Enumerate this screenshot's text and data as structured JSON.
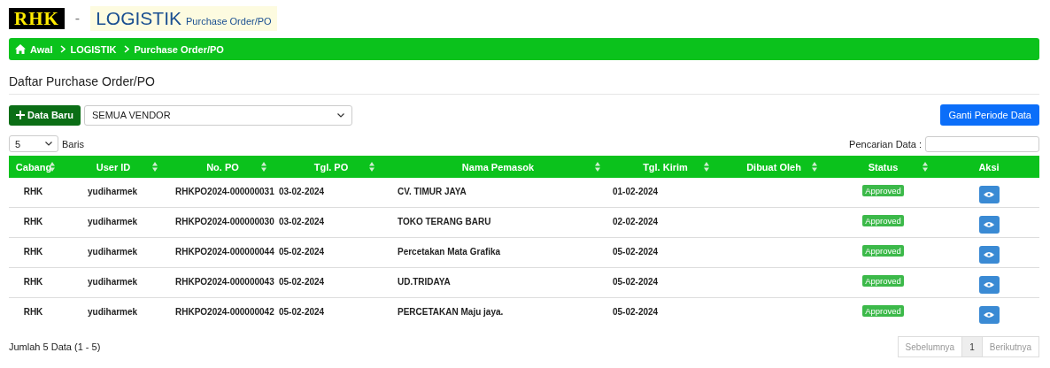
{
  "header": {
    "logo": "RHK",
    "separator": "-",
    "title": "LOGISTIK",
    "subtitle": "Purchase Order/PO"
  },
  "breadcrumb": [
    "Awal",
    "LOGISTIK",
    "Purchase Order/PO"
  ],
  "page_title": "Daftar Purchase Order/PO",
  "toolbar": {
    "new_button": "Data Baru",
    "vendor_select": "SEMUA VENDOR",
    "period_button": "Ganti Periode Data"
  },
  "page_size": {
    "value": "5",
    "label": "Baris"
  },
  "search": {
    "label": "Pencarian Data :"
  },
  "table": {
    "columns": [
      {
        "label": "Cabang",
        "sortable": true
      },
      {
        "label": "User ID",
        "sortable": true
      },
      {
        "label": "No. PO",
        "sortable": true
      },
      {
        "label": "Tgl. PO",
        "sortable": true
      },
      {
        "label": "Nama Pemasok",
        "sortable": true
      },
      {
        "label": "Tgl. Kirim",
        "sortable": true
      },
      {
        "label": "Dibuat Oleh",
        "sortable": true
      },
      {
        "label": "Status",
        "sortable": true
      },
      {
        "label": "Aksi",
        "sortable": false
      }
    ],
    "rows": [
      {
        "cabang": "RHK",
        "user_id": "yudiharmek",
        "no_po": "RHKPO2024-000000031",
        "tgl_po": "03-02-2024",
        "pemasok": "CV. TIMUR JAYA",
        "tgl_kirim": "01-02-2024",
        "status": "Approved"
      },
      {
        "cabang": "RHK",
        "user_id": "yudiharmek",
        "no_po": "RHKPO2024-000000030",
        "tgl_po": "03-02-2024",
        "pemasok": "TOKO TERANG BARU",
        "tgl_kirim": "02-02-2024",
        "status": "Approved"
      },
      {
        "cabang": "RHK",
        "user_id": "yudiharmek",
        "no_po": "RHKPO2024-000000044",
        "tgl_po": "05-02-2024",
        "pemasok": "Percetakan Mata Grafika",
        "tgl_kirim": "05-02-2024",
        "status": "Approved"
      },
      {
        "cabang": "RHK",
        "user_id": "yudiharmek",
        "no_po": "RHKPO2024-000000043",
        "tgl_po": "05-02-2024",
        "pemasok": "UD.TRIDAYA",
        "tgl_kirim": "05-02-2024",
        "status": "Approved"
      },
      {
        "cabang": "RHK",
        "user_id": "yudiharmek",
        "no_po": "RHKPO2024-000000042",
        "tgl_po": "05-02-2024",
        "pemasok": "PERCETAKAN Maju jaya.",
        "tgl_kirim": "05-02-2024",
        "status": "Approved"
      }
    ]
  },
  "footer": {
    "summary": "Jumlah 5 Data (1 - 5)"
  },
  "pagination": [
    {
      "label": "Sebelumnya",
      "selected": false,
      "disabled": true
    },
    {
      "label": "1",
      "selected": true,
      "disabled": false
    },
    {
      "label": "Berikutnya",
      "selected": false,
      "disabled": true
    }
  ]
}
